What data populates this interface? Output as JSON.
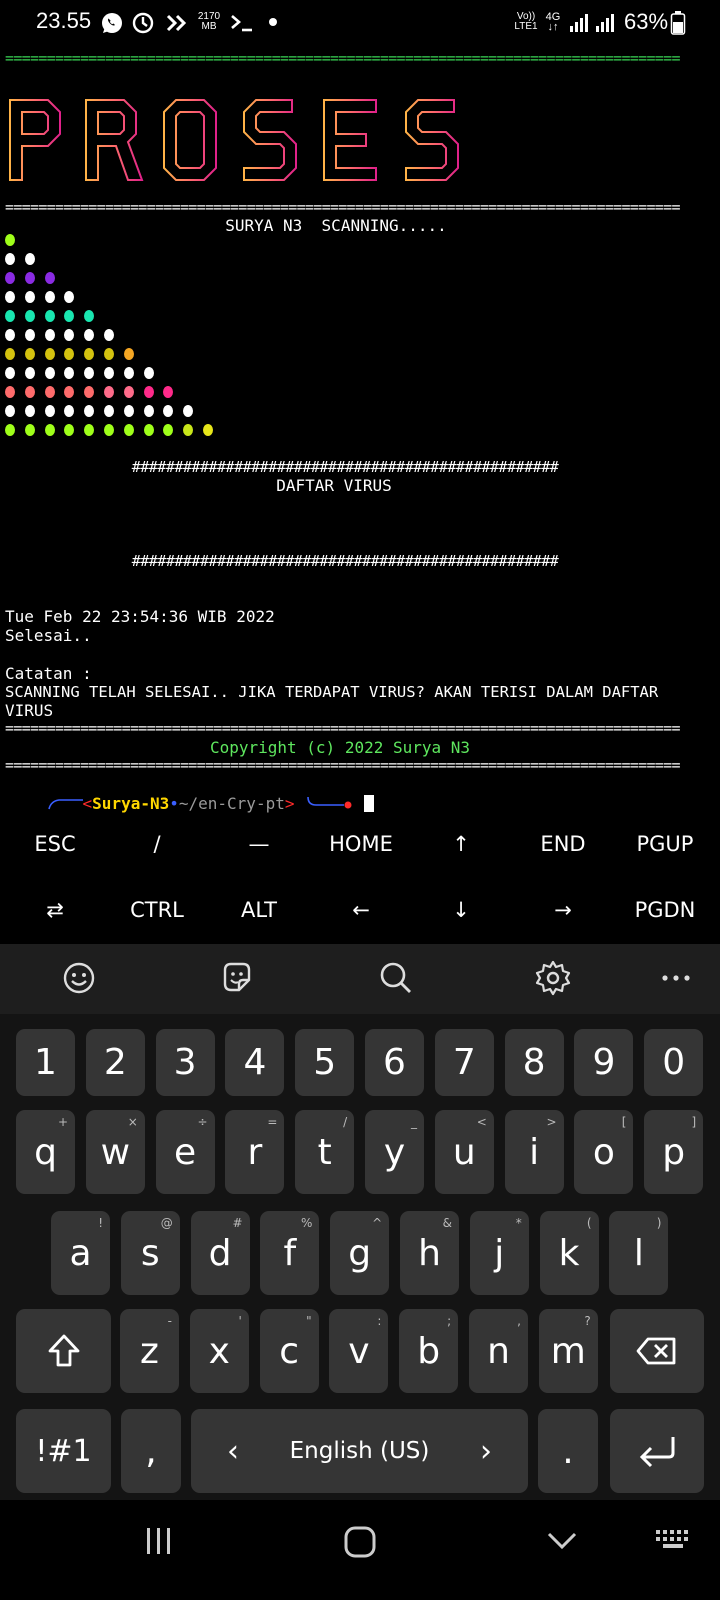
{
  "status_bar": {
    "time": "23.55",
    "data_speed_value": "2170",
    "data_speed_unit": "MB",
    "network_top": "Vo))",
    "network_bottom": "LTE1",
    "network_type": "4G",
    "battery": "63%",
    "icons": [
      "whatsapp-icon",
      "clock-icon",
      "fast-forward-icon",
      "terminal-icon",
      "dot-icon",
      "signal-icon",
      "battery-icon"
    ]
  },
  "terminal": {
    "separator_green": "=================================================================================",
    "banner_word": "PROSES",
    "separator_1": "==================================================================================",
    "scanning_title": "SURYA N3  SCANNING.....",
    "hash_line": "##################################################",
    "daftar_virus": "DAFTAR VIRUS",
    "timestamp": "Tue Feb 22 23:54:36 WIB 2022",
    "selesai": "Selesai..",
    "catatan_label": "Catatan :",
    "catatan_text_1": "SCANNING TELAH SELESAI.. JIKA TERDAPAT VIRUS? AKAN TERISI DALAM DAFTAR",
    "catatan_text_2": "VIRUS",
    "copyright": "Copyright (c) 2022 Surya N3",
    "prompt_user": "Surya-N3",
    "prompt_path": "~/en-Cry-pt",
    "colors": {
      "green_sep": "#39d353",
      "copyright": "#5ee65e",
      "banner_start": "#ffb347",
      "banner_end": "#e0218a"
    },
    "dot_rows": [
      [
        "#a0ff1a"
      ],
      [
        "#ffffff",
        "#ffffff"
      ],
      [
        "#8a2be2",
        "#8a2be2",
        "#8a2be2"
      ],
      [
        "#ffffff",
        "#ffffff",
        "#ffffff",
        "#ffffff"
      ],
      [
        "#19e6b0",
        "#19e6b0",
        "#19e6b0",
        "#19e6b0",
        "#19e6b0"
      ],
      [
        "#ffffff",
        "#ffffff",
        "#ffffff",
        "#ffffff",
        "#ffffff",
        "#ffffff"
      ],
      [
        "#d4c20f",
        "#d4c20f",
        "#d4c20f",
        "#d4c20f",
        "#d4c20f",
        "#d4c20f",
        "#f5a623"
      ],
      [
        "#ffffff",
        "#ffffff",
        "#ffffff",
        "#ffffff",
        "#ffffff",
        "#ffffff",
        "#ffffff",
        "#ffffff"
      ],
      [
        "#ff6b6b",
        "#ff6b6b",
        "#ff6b6b",
        "#ff6b6b",
        "#ff6b6b",
        "#ff6b8a",
        "#ff6b8a",
        "#ff2a8a",
        "#ff2a8a"
      ],
      [
        "#ffffff",
        "#ffffff",
        "#ffffff",
        "#ffffff",
        "#ffffff",
        "#ffffff",
        "#ffffff",
        "#ffffff",
        "#ffffff",
        "#ffffff"
      ],
      [
        "#a0ff1a",
        "#a0ff1a",
        "#a0ff1a",
        "#a0ff1a",
        "#a0ff1a",
        "#a0ff1a",
        "#a0ff1a",
        "#a0ff1a",
        "#a0ff1a",
        "#c8e61a",
        "#e6e61a"
      ]
    ]
  },
  "extra_keys": {
    "row1": [
      "ESC",
      "/",
      "—",
      "HOME",
      "↑",
      "END",
      "PGUP"
    ],
    "row2": [
      "⇄",
      "CTRL",
      "ALT",
      "←",
      "↓",
      "→",
      "PGDN"
    ]
  },
  "keyboard": {
    "toolbar_icons": [
      "emoji-icon",
      "sticker-icon",
      "search-icon",
      "settings-icon",
      "more-icon"
    ],
    "number_row": [
      "1",
      "2",
      "3",
      "4",
      "5",
      "6",
      "7",
      "8",
      "9",
      "0"
    ],
    "row_q": [
      {
        "k": "q",
        "s": "+"
      },
      {
        "k": "w",
        "s": "×"
      },
      {
        "k": "e",
        "s": "÷"
      },
      {
        "k": "r",
        "s": "="
      },
      {
        "k": "t",
        "s": "/"
      },
      {
        "k": "y",
        "s": "_"
      },
      {
        "k": "u",
        "s": "<"
      },
      {
        "k": "i",
        "s": ">"
      },
      {
        "k": "o",
        "s": "["
      },
      {
        "k": "p",
        "s": "]"
      }
    ],
    "row_a": [
      {
        "k": "a",
        "s": "!"
      },
      {
        "k": "s",
        "s": "@"
      },
      {
        "k": "d",
        "s": "#"
      },
      {
        "k": "f",
        "s": "%"
      },
      {
        "k": "g",
        "s": "^"
      },
      {
        "k": "h",
        "s": "&"
      },
      {
        "k": "j",
        "s": "*"
      },
      {
        "k": "k",
        "s": "("
      },
      {
        "k": "l",
        "s": ")"
      }
    ],
    "row_z": [
      {
        "k": "z",
        "s": "-"
      },
      {
        "k": "x",
        "s": "'"
      },
      {
        "k": "c",
        "s": "\""
      },
      {
        "k": "v",
        "s": ":"
      },
      {
        "k": "b",
        "s": ";"
      },
      {
        "k": "n",
        "s": ","
      },
      {
        "k": "m",
        "s": "?"
      }
    ],
    "symbols_key": "!#1",
    "comma_key": ",",
    "space_label": "English (US)",
    "space_left": "‹",
    "space_right": "›",
    "period_key": ".",
    "key_bg": "#353535"
  },
  "nav_bar": {
    "icons": [
      "recents-icon",
      "home-icon",
      "back-icon",
      "keyboard-hide-icon"
    ]
  }
}
